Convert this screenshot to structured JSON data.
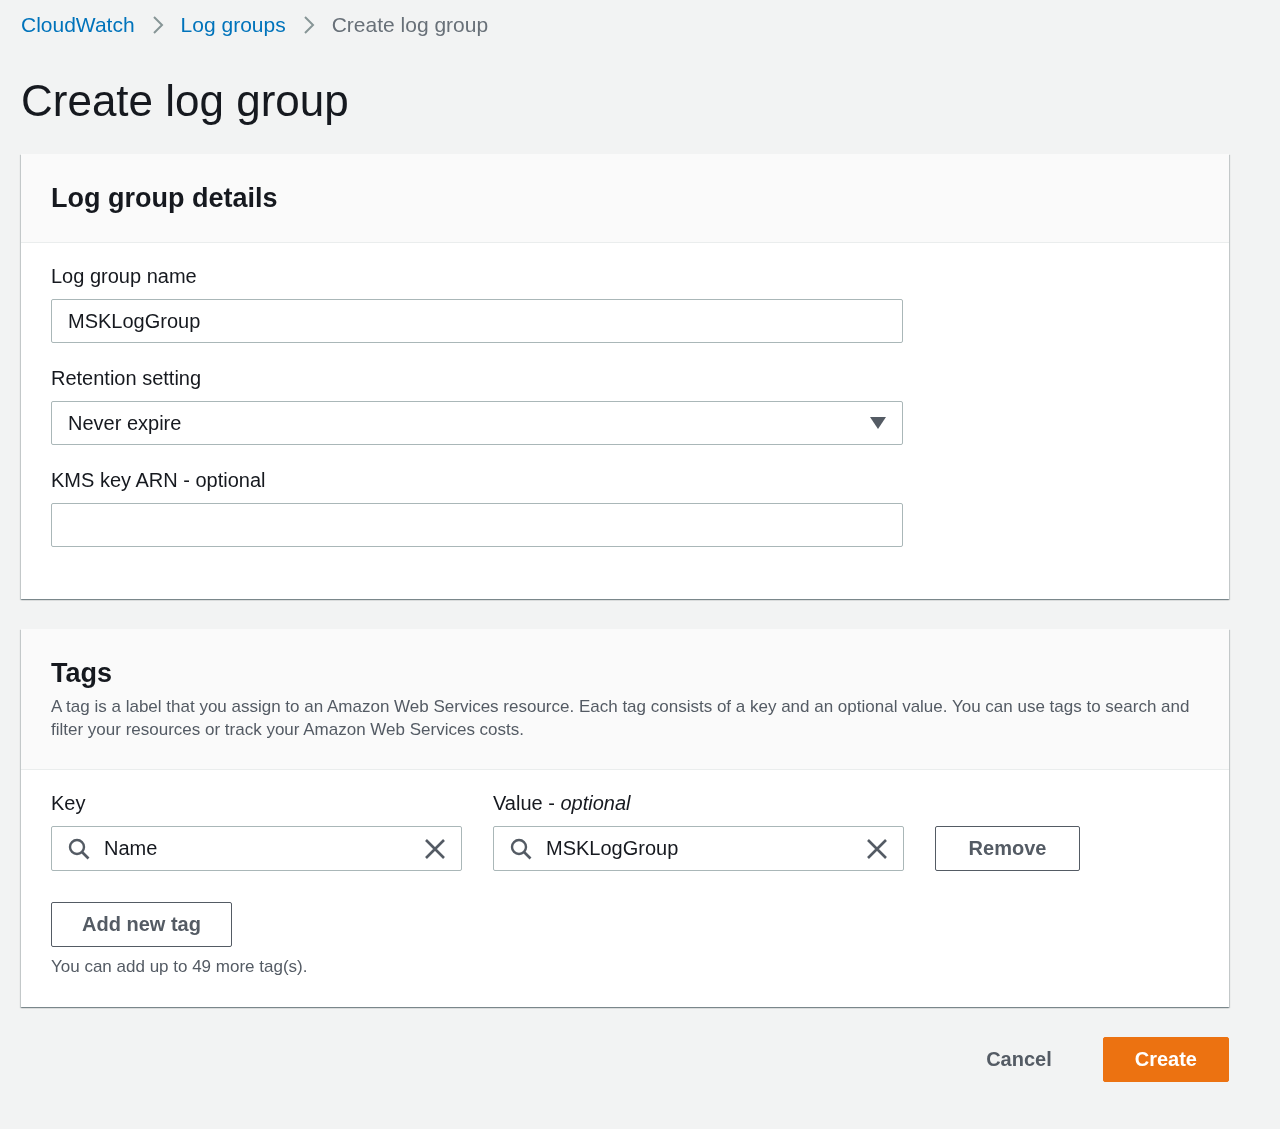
{
  "breadcrumbs": [
    {
      "label": "CloudWatch",
      "current": false
    },
    {
      "label": "Log groups",
      "current": false
    },
    {
      "label": "Create log group",
      "current": true
    }
  ],
  "page_title": "Create log group",
  "details_panel": {
    "title": "Log group details",
    "fields": [
      {
        "kind": "text",
        "label": "Log group name",
        "value": "MSKLogGroup"
      },
      {
        "kind": "select",
        "label": "Retention setting",
        "value": "Never expire"
      },
      {
        "kind": "text",
        "label": "KMS key ARN - optional"
      }
    ]
  },
  "tags_panel": {
    "title": "Tags",
    "description": "A tag is a label that you assign to an Amazon Web Services resource. Each tag consists of a key and an optional value. You can use tags to search and filter your resources or track your Amazon Web Services costs.",
    "tags": [
      {
        "key_label": "Key",
        "value_label": "Value - *optional*",
        "key": "Name",
        "value": "MSKLogGroup",
        "remove_button": "Remove"
      }
    ],
    "add_button": "Add new tag",
    "limit_note": "You can add up to 49 more tag(s)."
  },
  "actions": {
    "cancel": "Cancel",
    "create": "Create"
  }
}
